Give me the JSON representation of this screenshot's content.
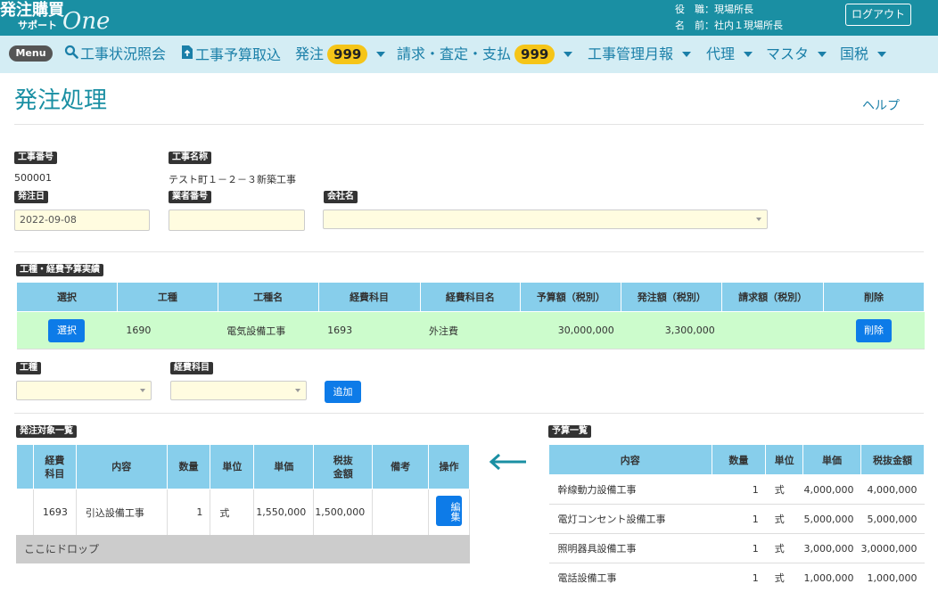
{
  "header": {
    "logo_line1": "発注購買",
    "logo_line2": "サポート",
    "logo_line3": "One",
    "role_label": "役　職：",
    "role_value": "現場所長",
    "name_label": "名　前：",
    "name_value": "社内１現場所長",
    "logout_label": "ログアウト"
  },
  "nav": {
    "menu_label": "Menu",
    "items": [
      {
        "label": "工事状況照会",
        "icon": "search-icon"
      },
      {
        "label": "工事予算取込",
        "icon": "file-upload-icon"
      },
      {
        "label": "発注",
        "badge": "999"
      },
      {
        "label": "請求・査定・支払",
        "badge": "999"
      },
      {
        "label": "工事管理月報"
      },
      {
        "label": "代理"
      },
      {
        "label": "マスタ"
      },
      {
        "label": "国税"
      }
    ]
  },
  "page": {
    "title": "発注処理",
    "help": "ヘルプ"
  },
  "form": {
    "koji_no_label": "工事番号",
    "koji_no_value": "500001",
    "koji_name_label": "工事名称",
    "koji_name_value": "テスト町１－２－３新築工事",
    "order_date_label": "発注日",
    "order_date_value": "2022-09-08",
    "vendor_no_label": "業者番号",
    "vendor_no_value": "",
    "company_label": "会社名",
    "company_value": ""
  },
  "budget": {
    "section_label": "工種・経費予算実績",
    "headers": [
      "選択",
      "工種",
      "工種名",
      "経費科目",
      "経費科目名",
      "予算額（税別）",
      "発注額（税別）",
      "請求額（税別）",
      "削除"
    ],
    "row": {
      "select_label": "選択",
      "koshu": "1690",
      "koshu_name": "電気設備工事",
      "keihi": "1693",
      "keihi_name": "外注費",
      "budget_amount": "30,000,000",
      "order_amount": "3,300,000",
      "invoice_amount": "",
      "delete_label": "削除"
    }
  },
  "add": {
    "koshu_label": "工種",
    "keihi_label": "経費科目",
    "add_label": "追加"
  },
  "orders": {
    "section_label": "発注対象一覧",
    "headers": [
      "",
      "経費\n科目",
      "内容",
      "数量",
      "単位",
      "単価",
      "税抜\n金額",
      "備考",
      "操作"
    ],
    "rows": [
      {
        "keihi": "1693",
        "content": "引込設備工事",
        "qty": "1",
        "unit": "式",
        "price": "1,550,000",
        "amount": "1,500,000",
        "note": "",
        "edit_label": "編集"
      }
    ],
    "drop_label": "ここにドロップ"
  },
  "estimates": {
    "section_label": "予算一覧",
    "headers": [
      "内容",
      "数量",
      "単位",
      "単価",
      "税抜金額"
    ],
    "rows": [
      {
        "content": "幹線動力設備工事",
        "qty": "1",
        "unit": "式",
        "price": "4,000,000",
        "amount": "4,000,000"
      },
      {
        "content": "電灯コンセント設備工事",
        "qty": "1",
        "unit": "式",
        "price": "5,000,000",
        "amount": "5,000,000"
      },
      {
        "content": "照明器具設備工事",
        "qty": "1",
        "unit": "式",
        "price": "3,000,000",
        "amount": "3,0000,000"
      },
      {
        "content": "電話設備工事",
        "qty": "1",
        "unit": "式",
        "price": "1,000,000",
        "amount": "1,000,000"
      }
    ]
  },
  "colors": {
    "header_teal": "#1a8fa3",
    "nav_bg": "#d4edf4",
    "badge": "#f5c518",
    "table_header": "#87ceeb",
    "row_green": "#ccfccc",
    "input_yellow": "#fffce0",
    "button_blue": "#0d7be8"
  }
}
